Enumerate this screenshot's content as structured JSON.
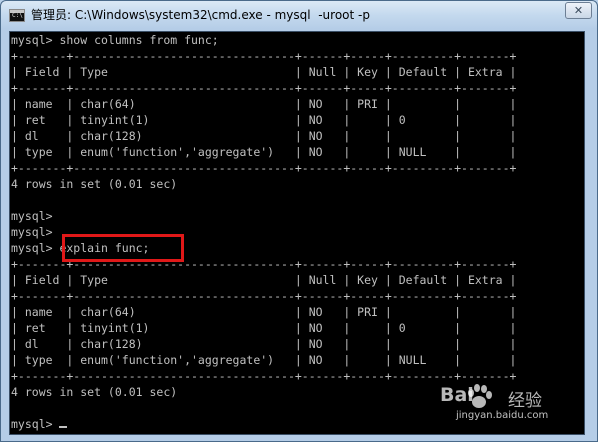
{
  "window": {
    "title": "管理员: C:\\Windows\\system32\\cmd.exe - mysql  -uroot -p",
    "close_glyph": "✕",
    "icon_label": "C:\\"
  },
  "terminal": {
    "lines": [
      "mysql> show columns from func;",
      "+-------+--------------------------------+------+-----+---------+-------+",
      "| Field | Type                           | Null | Key | Default | Extra |",
      "+-------+--------------------------------+------+-----+---------+-------+",
      "| name  | char(64)                       | NO   | PRI |         |       |",
      "| ret   | tinyint(1)                     | NO   |     | 0       |       |",
      "| dl    | char(128)                      | NO   |     |         |       |",
      "| type  | enum('function','aggregate')   | NO   |     | NULL    |       |",
      "+-------+--------------------------------+------+-----+---------+-------+",
      "4 rows in set (0.01 sec)",
      "",
      "mysql>",
      "mysql>",
      "mysql> explain func;",
      "+-------+--------------------------------+------+-----+---------+-------+",
      "| Field | Type                           | Null | Key | Default | Extra |",
      "+-------+--------------------------------+------+-----+---------+-------+",
      "| name  | char(64)                       | NO   | PRI |         |       |",
      "| ret   | tinyint(1)                     | NO   |     | 0       |       |",
      "| dl    | char(128)                      | NO   |     |         |       |",
      "| type  | enum('function','aggregate')   | NO   |     | NULL    |       |",
      "+-------+--------------------------------+------+-----+---------+-------+",
      "4 rows in set (0.01 sec)",
      "",
      "mysql> "
    ],
    "foreground": "#c0c0c0",
    "background": "#000000",
    "highlight_color": "#e01818"
  },
  "watermark": {
    "brand": "Bai",
    "brand_suffix": "经验",
    "url": "jingyan.baidu.com"
  }
}
